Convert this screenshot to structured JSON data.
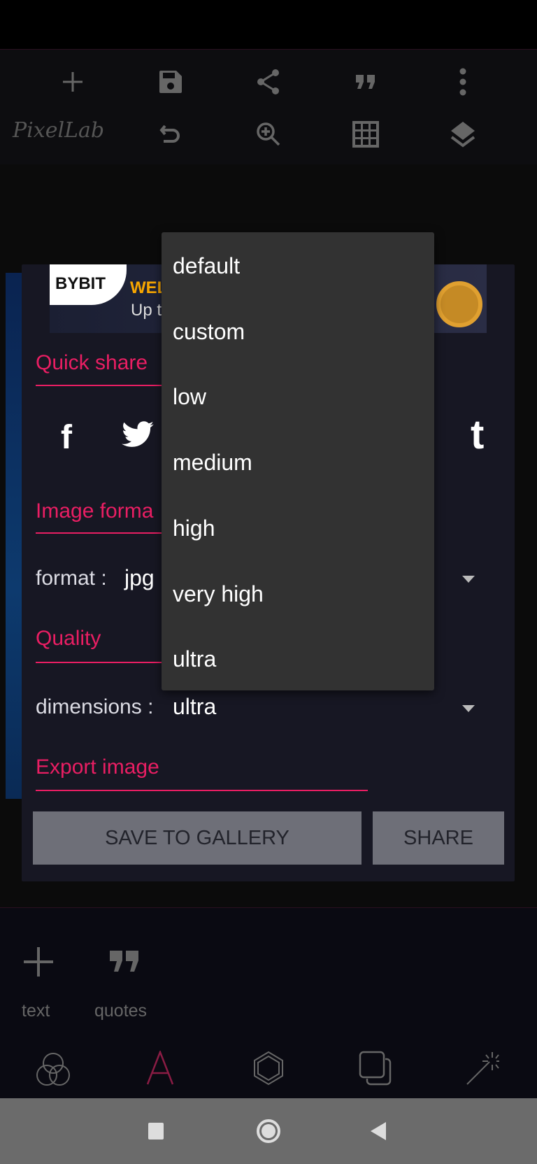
{
  "app": {
    "logo": "PixelLab"
  },
  "toolbar": {
    "row1": [
      "plus-icon",
      "save-icon",
      "share-icon",
      "quote-icon",
      "more-vert-icon"
    ],
    "row2": [
      "undo-icon",
      "zoom-in-icon",
      "grid-icon",
      "layers-icon"
    ]
  },
  "ad": {
    "brand": "BYBIT",
    "headline": "WEL",
    "sub": "Up t"
  },
  "dialog": {
    "quick_share": "Quick share",
    "social": [
      "facebook-icon",
      "twitter-icon",
      "tumblr-icon"
    ],
    "image_format": "Image forma",
    "format_label": "format :",
    "format_value": "jpg",
    "quality": "Quality",
    "dimensions_label": "dimensions :",
    "dimensions_value": "ultra",
    "export": "Export image",
    "save_button": "SAVE TO GALLERY",
    "share_button": "SHARE"
  },
  "menu": {
    "items": [
      "default",
      "custom",
      "low",
      "medium",
      "high",
      "very high",
      "ultra"
    ]
  },
  "bottom": {
    "tools": [
      {
        "label": "text"
      },
      {
        "label": "quotes"
      }
    ],
    "tabs": [
      "blend-icon",
      "text-icon",
      "shape-icon",
      "copy-icon",
      "effects-icon"
    ]
  },
  "colors": {
    "accent": "#e91e63",
    "dialog": "#171723",
    "menu": "#323232",
    "button": "#6e6f78"
  }
}
